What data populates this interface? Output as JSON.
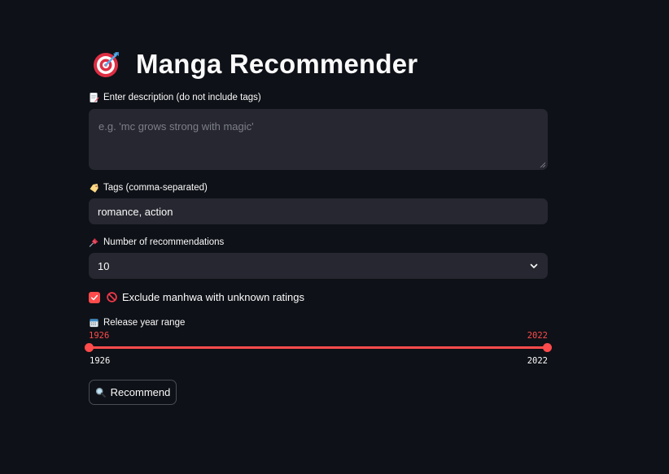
{
  "header": {
    "title": "Manga Recommender",
    "icon": "target-dart-icon"
  },
  "description": {
    "label": "Enter description (do not include tags)",
    "label_icon": "memo-icon",
    "placeholder": "e.g. 'mc grows strong with magic'",
    "value": ""
  },
  "tags": {
    "label": "Tags (comma-separated)",
    "label_icon": "label-tag-icon",
    "value": "romance, action"
  },
  "num_recs": {
    "label": "Number of recommendations",
    "label_icon": "pushpin-icon",
    "selected": "10",
    "control_icon": "chevron-down-icon"
  },
  "exclude": {
    "checked": true,
    "label_icon": "no-entry-icon",
    "label": "Exclude manhwa with unknown ratings"
  },
  "year_range": {
    "label": "Release year range",
    "label_icon": "calendar-icon",
    "selected_min": "1926",
    "selected_max": "2022",
    "range_min": "1926",
    "range_max": "2022"
  },
  "recommend_button": {
    "icon": "magnifier-icon",
    "label": "Recommend"
  },
  "colors": {
    "background": "#0e1117",
    "input_bg": "#262730",
    "accent": "#ff4b4b",
    "text": "#fafafa"
  }
}
